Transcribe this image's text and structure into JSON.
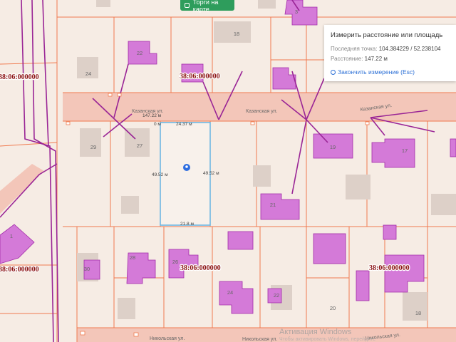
{
  "toggle": {
    "label": "Торги на карте"
  },
  "panel": {
    "title": "Измерить расстояние или площадь",
    "last_point_label": "Последняя точка:",
    "last_point_value": "104.384229 / 52.238104",
    "distance_label": "Расстояние:",
    "distance_value": "147.22 м",
    "finish_label": "Закончить измерение (Esc)"
  },
  "labels": {
    "zone1": "38:06:000000",
    "zone2": "38:06:000000",
    "zone3": "38:06:000000",
    "zone4": "38:06:000000",
    "zone5": "38:06:000000",
    "street1": "Казанская ул.",
    "street2": "Казанская ул.",
    "street3": "Никольская ул.",
    "street4": "Никольская ул."
  },
  "measure": {
    "total": "147.22 м",
    "zero": "0 м",
    "top": "24.37 м",
    "left": "49.52 м",
    "right": "49.52 м",
    "bottom": "21.8 м"
  },
  "lots": [
    "3",
    "18",
    "22",
    "24",
    "29",
    "27",
    "19",
    "17",
    "21",
    "1",
    "30",
    "28",
    "26",
    "24",
    "22",
    "20",
    "18"
  ],
  "watermark": {
    "line1": "Активация Windows",
    "line2": "Чтобы активировать Windows, перейдите"
  },
  "colors": {
    "background": "#f6ece4",
    "parcel": "#f07a4f",
    "building": "#d47ad8",
    "road": "#f3c6b9",
    "measure": "#6fb7e3",
    "accent": "#2e9d5c"
  }
}
